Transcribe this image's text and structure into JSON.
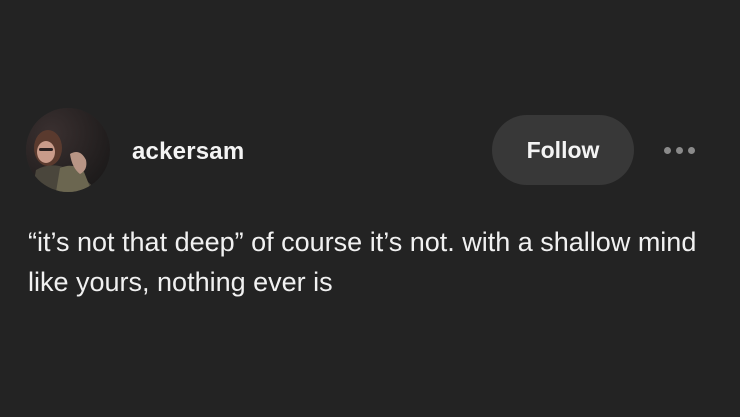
{
  "post": {
    "author": {
      "username": "ackersam",
      "avatar_icon": "avatar-photo"
    },
    "follow_label": "Follow",
    "more_icon": "more-horizontal-icon",
    "body_text": "“it’s not that deep” of course it’s not. with a shallow mind like yours, nothing ever is"
  },
  "colors": {
    "background": "#232323",
    "follow_button_bg": "#383838",
    "text": "#f1f1f1",
    "more_dots": "#8a8a8a"
  }
}
